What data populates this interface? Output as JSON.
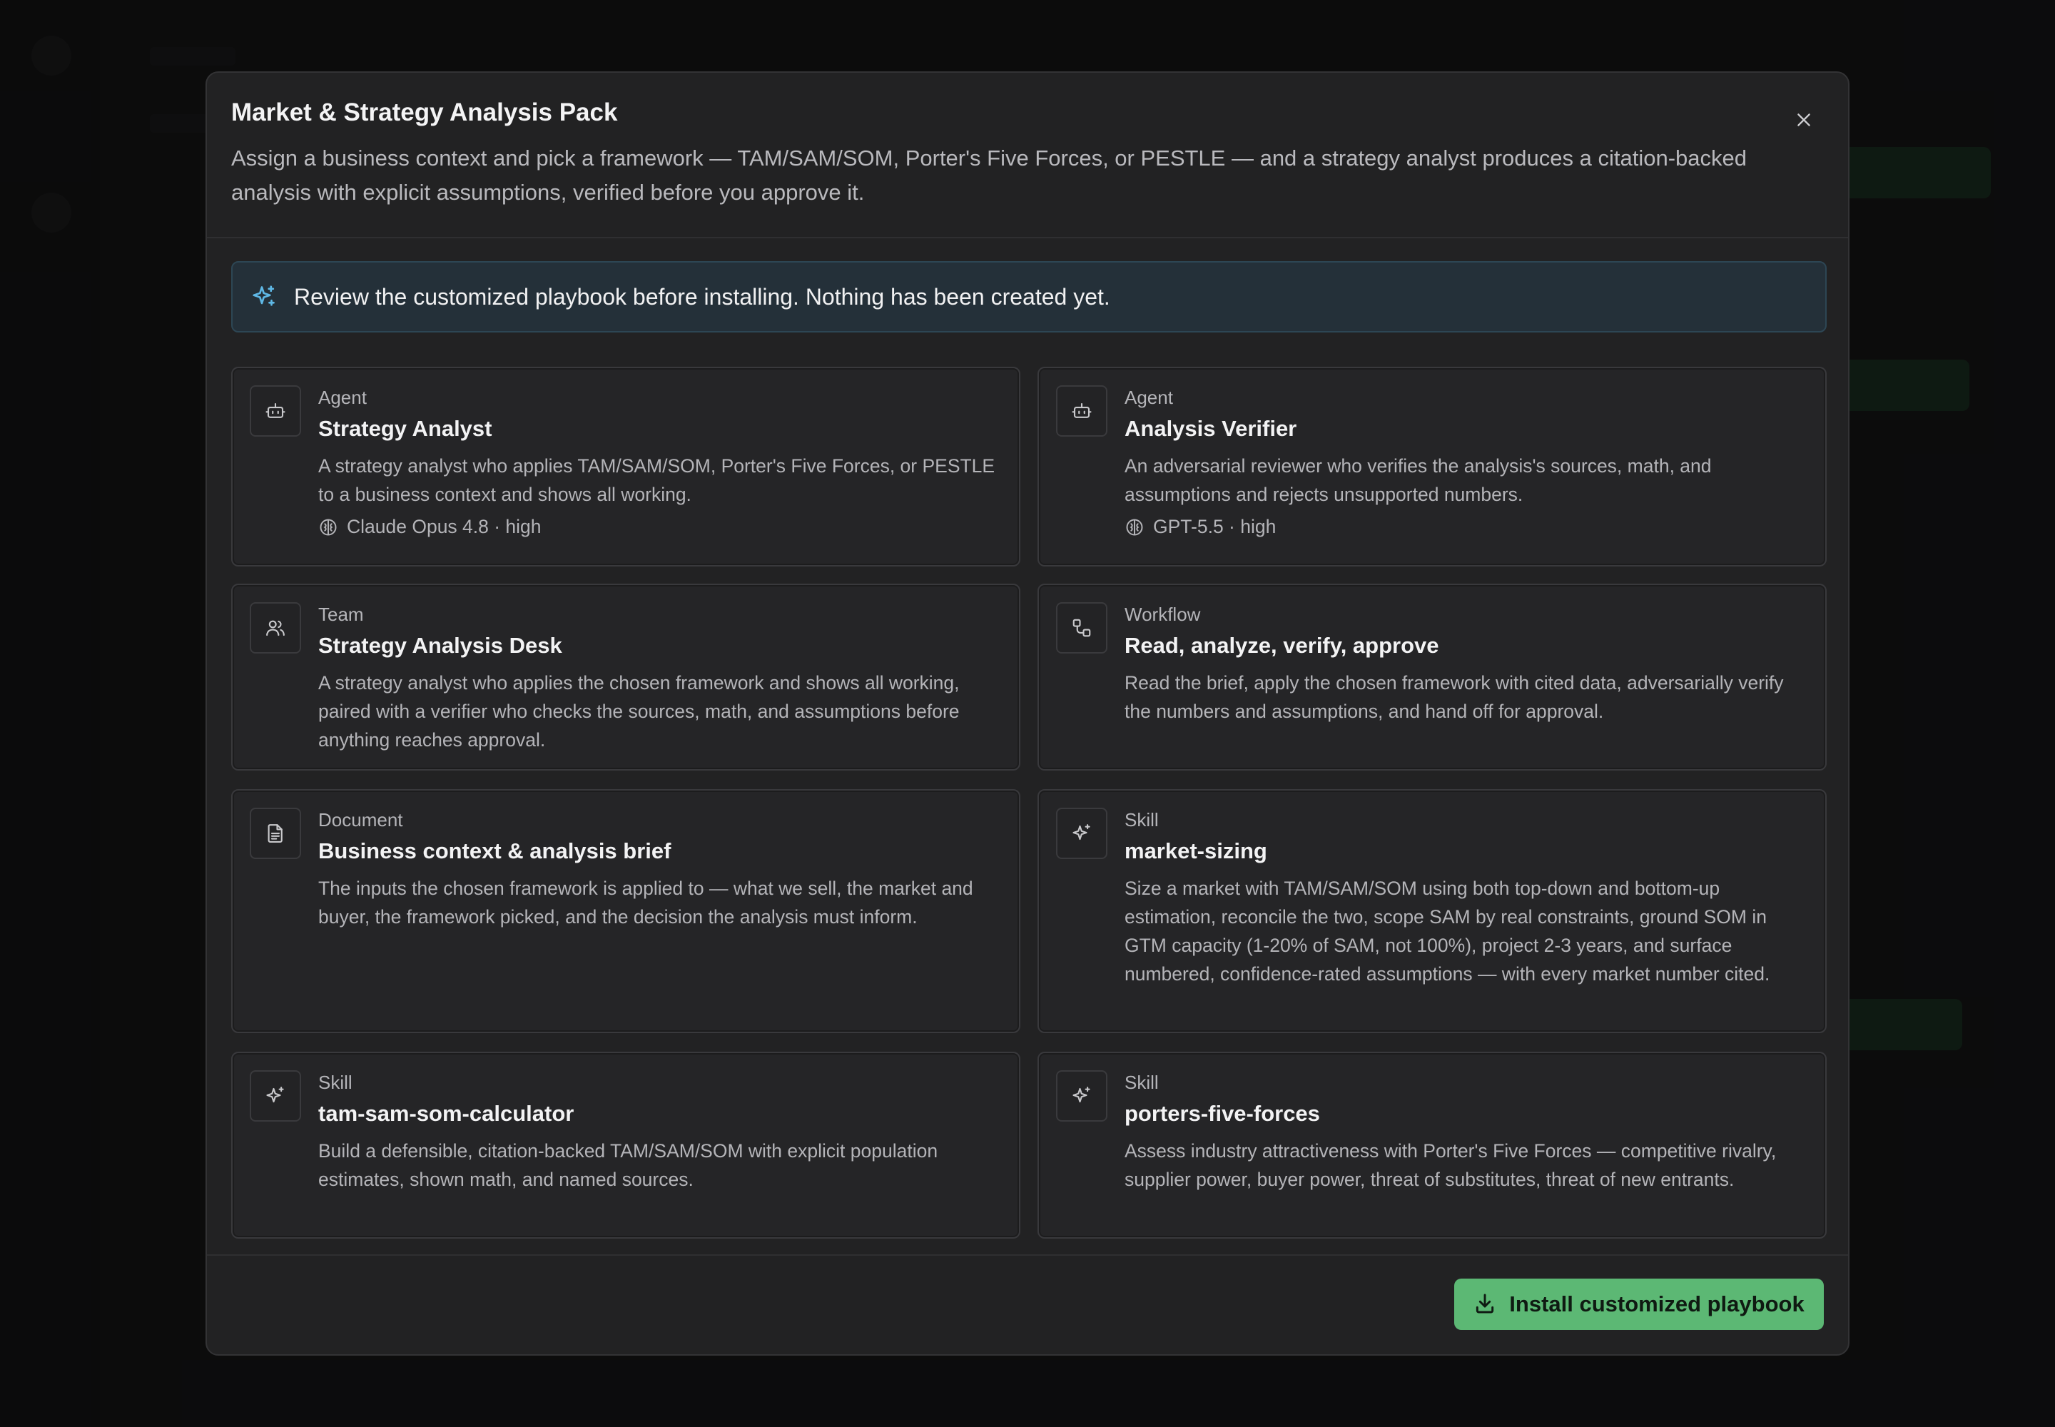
{
  "modal": {
    "title": "Market & Strategy Analysis Pack",
    "subtitle": "Assign a business context and pick a framework — TAM/SAM/SOM, Porter's Five Forces, or PESTLE — and a strategy analyst produces a citation-backed analysis with explicit assumptions, verified before you approve it.",
    "close_icon": "x-icon"
  },
  "notice": {
    "icon": "sparkles-icon",
    "text": "Review the customized playbook before installing. Nothing has been created yet."
  },
  "items": [
    {
      "kind": "Agent",
      "icon": "bot-icon",
      "title": "Strategy Analyst",
      "description": "A strategy analyst who applies TAM/SAM/SOM, Porter's Five Forces, or PESTLE to a business context and shows all working.",
      "model": "Claude Opus 4.8 · high"
    },
    {
      "kind": "Agent",
      "icon": "bot-icon",
      "title": "Analysis Verifier",
      "description": "An adversarial reviewer who verifies the analysis's sources, math, and assumptions and rejects unsupported numbers.",
      "model": "GPT-5.5 · high"
    },
    {
      "kind": "Team",
      "icon": "users-icon",
      "title": "Strategy Analysis Desk",
      "description": "A strategy analyst who applies the chosen framework and shows all working, paired with a verifier who checks the sources, math, and assumptions before anything reaches approval."
    },
    {
      "kind": "Workflow",
      "icon": "workflow-icon",
      "title": "Read, analyze, verify, approve",
      "description": "Read the brief, apply the chosen framework with cited data, adversarially verify the numbers and assumptions, and hand off for approval."
    },
    {
      "kind": "Document",
      "icon": "document-icon",
      "title": "Business context & analysis brief",
      "description": "The inputs the chosen framework is applied to — what we sell, the market and buyer, the framework picked, and the decision the analysis must inform."
    },
    {
      "kind": "Skill",
      "icon": "sparkles-icon",
      "title": "market-sizing",
      "description": "Size a market with TAM/SAM/SOM using both top-down and bottom-up estimation, reconcile the two, scope SAM by real constraints, ground SOM in GTM capacity (1-20% of SAM, not 100%), project 2-3 years, and surface numbered, confidence-rated assumptions — with every market number cited."
    },
    {
      "kind": "Skill",
      "icon": "sparkles-icon",
      "title": "tam-sam-som-calculator",
      "description": "Build a defensible, citation-backed TAM/SAM/SOM with explicit population estimates, shown math, and named sources."
    },
    {
      "kind": "Skill",
      "icon": "sparkles-icon",
      "title": "porters-five-forces",
      "description": "Assess industry attractiveness with Porter's Five Forces — competitive rivalry, supplier power, buyer power, threat of substitutes, threat of new entrants."
    }
  ],
  "footer": {
    "install_label": "Install customized playbook",
    "install_icon": "download-icon"
  },
  "colors": {
    "accent_green": "#5cb874",
    "notice_bg": "#243039",
    "notice_icon": "#5fb8e6"
  }
}
